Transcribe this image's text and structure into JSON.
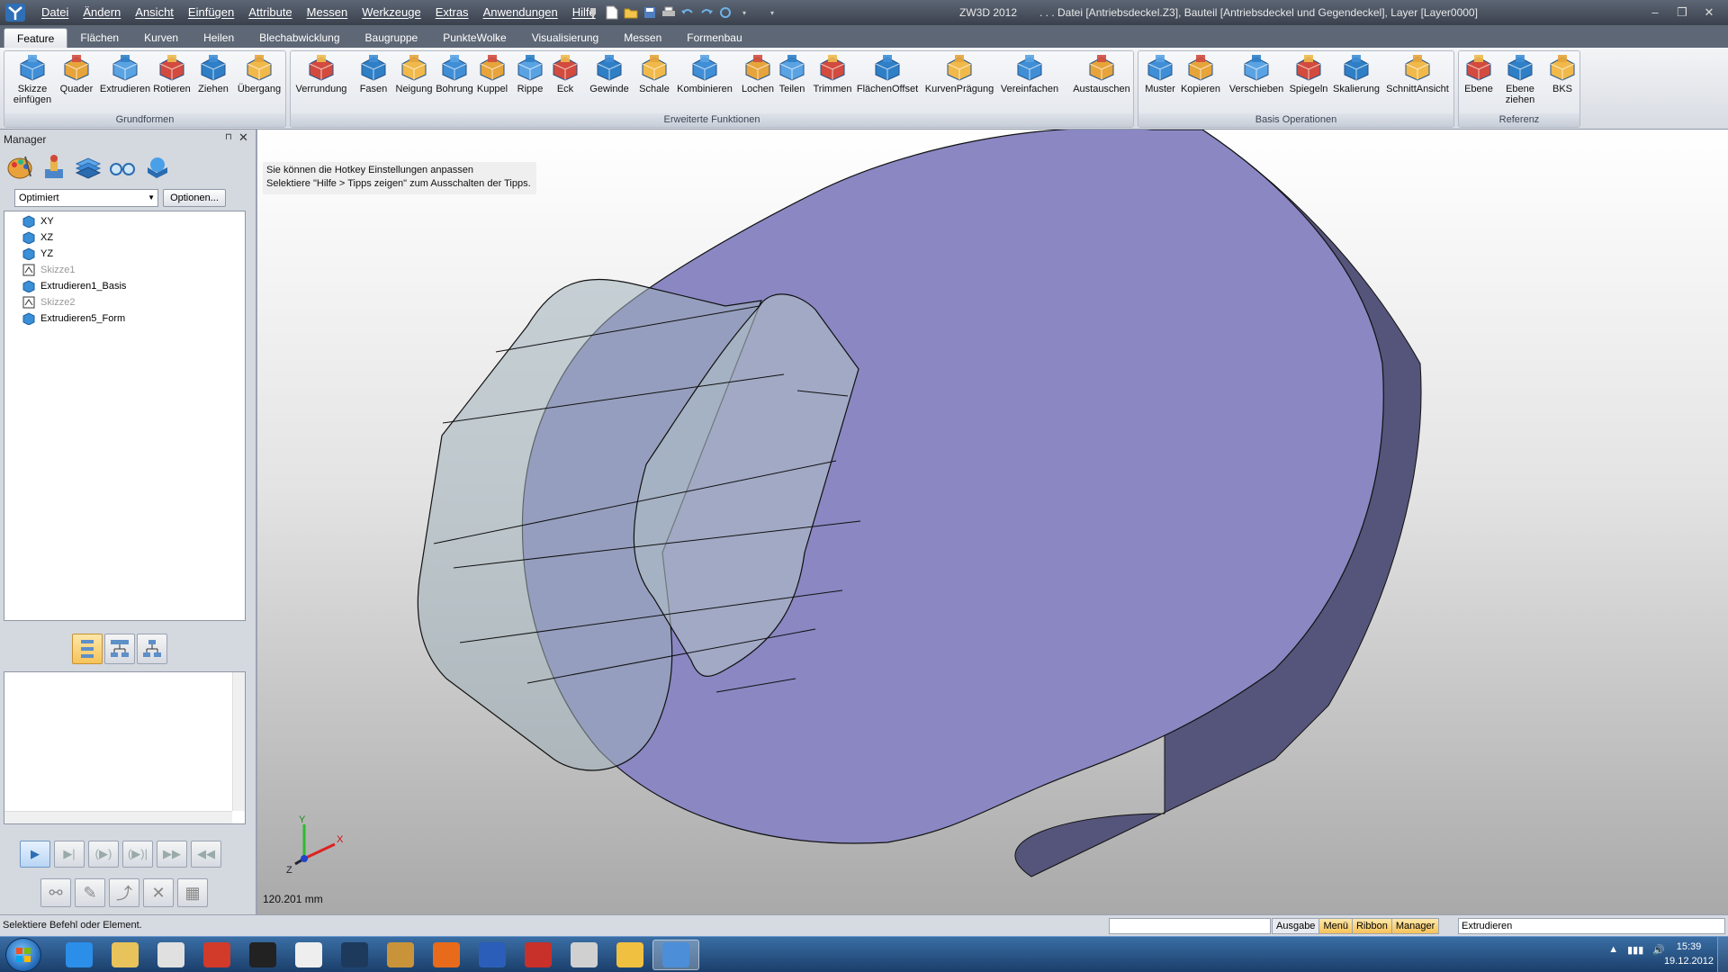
{
  "titlebar": {
    "app_name": "ZW3D 2012",
    "document": ". . . Datei [Antriebsdeckel.Z3],  Bauteil [Antriebsdeckel und Gegendeckel],  Layer [Layer0000]",
    "menus": [
      "Datei",
      "Ändern",
      "Ansicht",
      "Einfügen",
      "Attribute",
      "Messen",
      "Werkzeuge",
      "Extras",
      "Anwendungen",
      "Hilfe"
    ],
    "window_controls": [
      "–",
      "❐",
      "✕"
    ]
  },
  "ribbon": {
    "tabs": [
      "Feature",
      "Flächen",
      "Kurven",
      "Heilen",
      "Blechabwicklung",
      "Baugruppe",
      "PunkteWolke",
      "Visualisierung",
      "Messen",
      "Formenbau"
    ],
    "active_tab": "Feature",
    "groups": [
      {
        "label": "Grundformen",
        "buttons": [
          {
            "label": "Skizze einfügen",
            "icon": "sketch-icon"
          },
          {
            "label": "Quader",
            "icon": "box-icon"
          },
          {
            "label": "Extrudieren",
            "icon": "extrude-icon"
          },
          {
            "label": "Rotieren",
            "icon": "revolve-icon"
          },
          {
            "label": "Ziehen",
            "icon": "sweep-icon"
          },
          {
            "label": "Übergang",
            "icon": "loft-icon"
          }
        ]
      },
      {
        "label": "Erweiterte Funktionen",
        "buttons": [
          {
            "label": "Verrundung",
            "icon": "fillet-icon"
          },
          {
            "label": "Fasen",
            "icon": "chamfer-icon"
          },
          {
            "label": "Neigung",
            "icon": "draft-icon"
          },
          {
            "label": "Bohrung",
            "icon": "hole-icon"
          },
          {
            "label": "Kuppel",
            "icon": "dome-icon"
          },
          {
            "label": "Rippe",
            "icon": "rib-icon"
          },
          {
            "label": "Eck",
            "icon": "corner-icon"
          },
          {
            "label": "Gewinde",
            "icon": "thread-icon"
          },
          {
            "label": "Schale",
            "icon": "shell-icon"
          },
          {
            "label": "Kombinieren",
            "icon": "combine-icon"
          },
          {
            "label": "Lochen",
            "icon": "punch-icon"
          },
          {
            "label": "Teilen",
            "icon": "split-icon"
          },
          {
            "label": "Trimmen",
            "icon": "trim-icon"
          },
          {
            "label": "FlächenOffset",
            "icon": "face-offset-icon"
          },
          {
            "label": "KurvenPrägung",
            "icon": "emboss-icon"
          },
          {
            "label": "Vereinfachen",
            "icon": "simplify-icon"
          },
          {
            "label": "Austauschen",
            "icon": "replace-icon"
          }
        ]
      },
      {
        "label": "Basis Operationen",
        "buttons": [
          {
            "label": "Muster",
            "icon": "pattern-icon"
          },
          {
            "label": "Kopieren",
            "icon": "copy-icon"
          },
          {
            "label": "Verschieben",
            "icon": "move-icon"
          },
          {
            "label": "Spiegeln",
            "icon": "mirror-icon"
          },
          {
            "label": "Skalierung",
            "icon": "scale-icon"
          },
          {
            "label": "SchnittAnsicht",
            "icon": "section-view-icon"
          }
        ]
      },
      {
        "label": "Referenz",
        "buttons": [
          {
            "label": "Ebene",
            "icon": "plane-icon"
          },
          {
            "label": "Ebene ziehen",
            "icon": "drag-plane-icon"
          },
          {
            "label": "BKS",
            "icon": "ucs-icon"
          }
        ]
      }
    ]
  },
  "manager": {
    "title": "Manager",
    "pin": "⊓",
    "close": "✕",
    "mode": "Optimiert",
    "options_label": "Optionen...",
    "tree": [
      {
        "label": "XY",
        "icon": "datum-plane-icon",
        "dim": false
      },
      {
        "label": "XZ",
        "icon": "datum-plane-icon",
        "dim": false
      },
      {
        "label": "YZ",
        "icon": "datum-plane-icon",
        "dim": false
      },
      {
        "label": "Skizze1",
        "icon": "sketch-node-icon",
        "dim": true
      },
      {
        "label": "Extrudieren1_Basis",
        "icon": "extrude-node-icon",
        "dim": false
      },
      {
        "label": "Skizze2",
        "icon": "sketch-node-icon",
        "dim": true
      },
      {
        "label": "Extrudieren5_Form",
        "icon": "extrude-node-icon",
        "dim": false
      }
    ]
  },
  "viewport": {
    "tip_line1": "Sie können die Hotkey Einstellungen anpassen",
    "tip_line2": "Selektiere \"Hilfe > Tipps zeigen\" zum Ausschalten der Tipps.",
    "scale": "120.201 mm",
    "axes": {
      "x": "X",
      "y": "Y",
      "z": "Z"
    },
    "colors": {
      "body": "#8a87c3",
      "body_side": "#55547a",
      "ghost": "#9fb1b9"
    }
  },
  "status": {
    "message": "Selektiere Befehl oder Element.",
    "tabs": [
      "Ausgabe",
      "Menü",
      "Ribbon",
      "Manager"
    ],
    "command": "Extrudieren"
  },
  "taskbar": {
    "time": "15:39",
    "date": "19.12.2012",
    "apps": [
      "explorer-ie-icon",
      "folder-icon",
      "media-player-icon",
      "app-red-icon",
      "nfs-icon",
      "soccer-icon",
      "console-icon",
      "figure-icon",
      "firefox-icon",
      "word-icon",
      "app-m-icon",
      "pin-icon",
      "weather-icon",
      "zw3d-icon"
    ]
  }
}
